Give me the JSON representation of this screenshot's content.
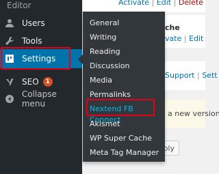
{
  "sidebar": {
    "top_label": "Editor",
    "items": [
      {
        "label": "Users",
        "icon": "users-icon"
      },
      {
        "label": "Tools",
        "icon": "wrench-icon"
      },
      {
        "label": "Settings",
        "icon": "settings-icon"
      },
      {
        "label": "SEO",
        "icon": "yoast-icon",
        "badge": "1"
      },
      {
        "label": "Collapse menu",
        "icon": "collapse-icon"
      }
    ]
  },
  "settings_flyout": {
    "items": [
      {
        "label": "General"
      },
      {
        "label": "Writing"
      },
      {
        "label": "Reading"
      },
      {
        "label": "Discussion"
      },
      {
        "label": "Media"
      },
      {
        "label": "Permalinks"
      },
      {
        "label": "Nextend FB Connect"
      },
      {
        "label": "Akismet"
      },
      {
        "label": "WP Super Cache"
      },
      {
        "label": "Meta Tag Manager"
      }
    ]
  },
  "content": {
    "row1": {
      "activate": "Activate",
      "sep1": "|",
      "edit": "Edit",
      "sep2": "|",
      "delete": "Delete"
    },
    "row2": {
      "title": "che",
      "activate": "vate",
      "sep": "|",
      "edit": "Edit"
    },
    "row3": {
      "support": "Support",
      "sep": "|",
      "settings": "Sett"
    },
    "notice": "a new version",
    "apply_button": "pply"
  },
  "colors": {
    "sidebar_bg": "#23282d",
    "flyout_bg": "#32373c",
    "active_bg": "#0073aa",
    "current_link": "#00b9eb",
    "highlight_border": "#e1001a",
    "badge_bg": "#d54e21"
  }
}
